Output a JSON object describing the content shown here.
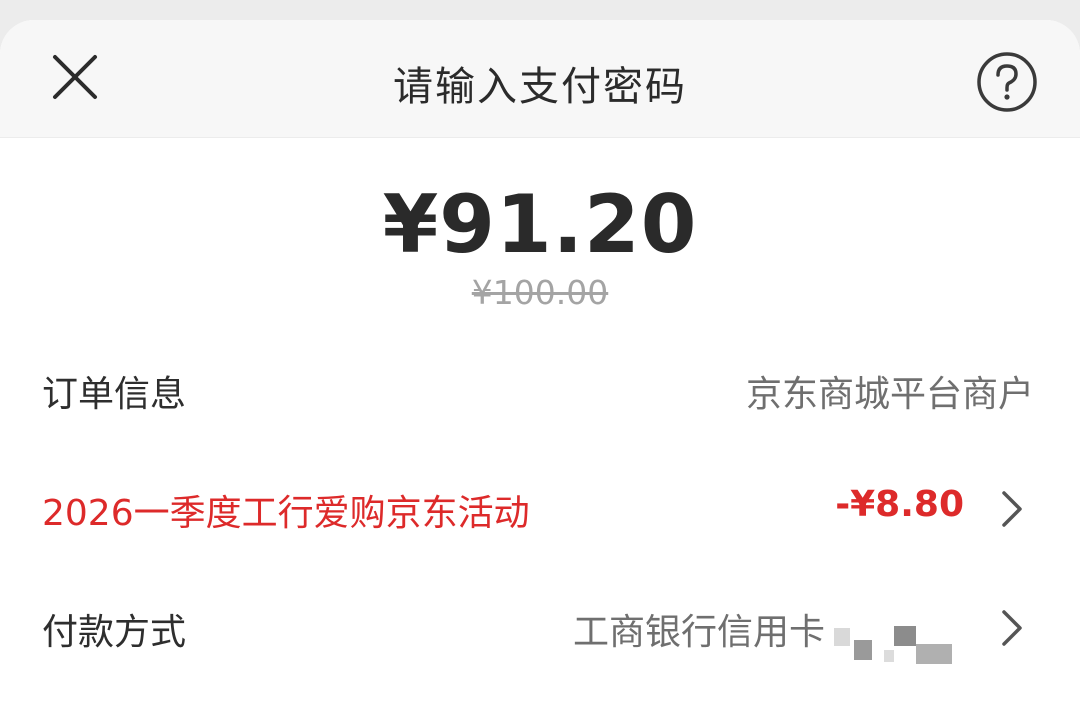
{
  "header": {
    "title": "请输入支付密码",
    "close_icon": "close-icon",
    "help_icon": "help-icon"
  },
  "payment": {
    "amount": "¥91.20",
    "original_amount": "¥100.00"
  },
  "rows": {
    "order_label": "订单信息",
    "order_value": "京东商城平台商户",
    "promo_label": "2026一季度工行爱购京东活动",
    "promo_value": "-¥8.80",
    "method_label": "付款方式",
    "method_value": "工商银行信用卡"
  },
  "colors": {
    "promo_red": "#dd2a2a",
    "text_dark": "#2b2b2b",
    "text_gray": "#6f6f6f",
    "strike_gray": "#a4a4a4"
  }
}
